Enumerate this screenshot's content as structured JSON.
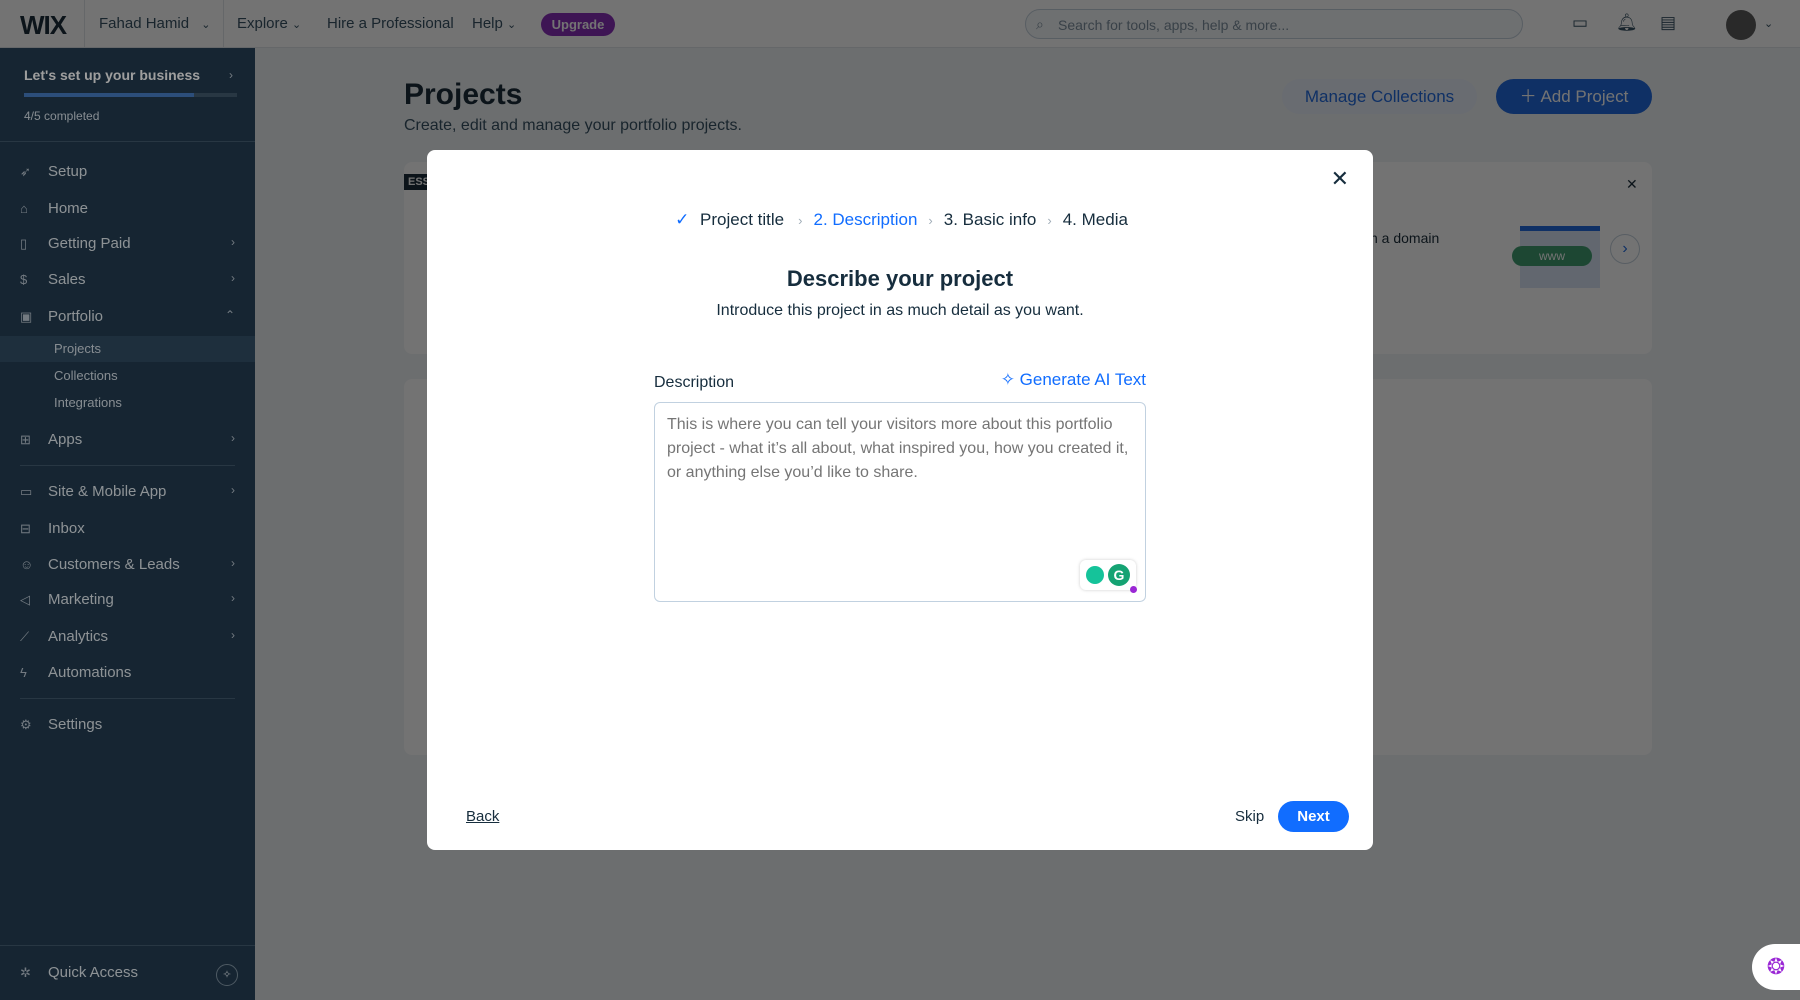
{
  "topbar": {
    "logo": "WIX",
    "account": "Fahad Hamid",
    "explore": "Explore",
    "hire": "Hire a Professional",
    "help": "Help",
    "upgrade": "Upgrade",
    "search_placeholder": "Search for tools, apps, help & more..."
  },
  "sidebar": {
    "setup_title": "Let's set up your business",
    "progress_text": "4/5 completed",
    "progress": 0.8,
    "items": [
      {
        "label": "Setup"
      },
      {
        "label": "Home"
      },
      {
        "label": "Getting Paid"
      },
      {
        "label": "Sales"
      },
      {
        "label": "Portfolio"
      },
      {
        "label": "Apps"
      },
      {
        "label": "Site & Mobile App"
      },
      {
        "label": "Inbox"
      },
      {
        "label": "Customers & Leads"
      },
      {
        "label": "Marketing"
      },
      {
        "label": "Analytics"
      },
      {
        "label": "Automations"
      },
      {
        "label": "Settings"
      }
    ],
    "portfolio_sub": [
      {
        "label": "Projects"
      },
      {
        "label": "Collections"
      },
      {
        "label": "Integrations"
      }
    ],
    "quick_access": "Quick Access"
  },
  "page": {
    "title": "Projects",
    "subtitle": "Create, edit and manage your portfolio projects.",
    "manage": "Manage Collections",
    "add": "Add Project",
    "badge": "ESS",
    "banner_text": "h a domain",
    "www": "www"
  },
  "modal": {
    "steps": [
      "Project title",
      "2. Description",
      "3. Basic info",
      "4. Media"
    ],
    "title": "Describe your project",
    "subtitle": "Introduce this project in as much detail as you want.",
    "desc_label": "Description",
    "ai": "Generate AI Text",
    "placeholder": "This is where you can tell your visitors more about this portfolio project - what it’s all about, what inspired you, how you created it, or anything else you’d like to share.",
    "back": "Back",
    "skip": "Skip",
    "next": "Next"
  },
  "colors": {
    "accent": "#116dff",
    "upgrade": "#9a27d5",
    "sidebar": "#1e3d56"
  }
}
